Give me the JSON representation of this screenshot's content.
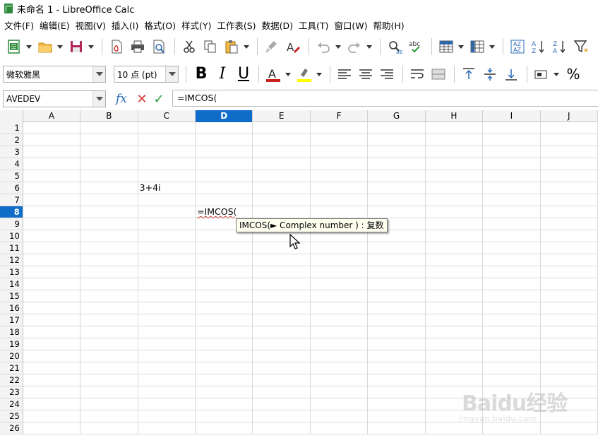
{
  "window": {
    "title": "未命名 1 - LibreOffice Calc"
  },
  "menu": [
    "文件(F)",
    "编辑(E)",
    "视图(V)",
    "插入(I)",
    "格式(O)",
    "样式(Y)",
    "工作表(S)",
    "数据(D)",
    "工具(T)",
    "窗口(W)",
    "帮助(H)"
  ],
  "format": {
    "font_name": "微软雅黑",
    "font_size": "10 点 (pt)",
    "bold": "B",
    "italic": "I",
    "underline": "U",
    "percent": "%"
  },
  "formula_bar": {
    "name_box": "AVEDEV",
    "fx": "fx",
    "cancel": "✕",
    "accept": "✓",
    "content": "=IMCOS("
  },
  "columns": [
    "A",
    "B",
    "C",
    "D",
    "E",
    "F",
    "G",
    "H",
    "I",
    "J"
  ],
  "selected_column": "D",
  "rows": [
    "1",
    "2",
    "3",
    "4",
    "5",
    "6",
    "7",
    "8",
    "9",
    "10",
    "11",
    "12",
    "13",
    "14",
    "15",
    "16",
    "17",
    "18",
    "19",
    "20",
    "21",
    "22",
    "23",
    "24",
    "25",
    "26"
  ],
  "selected_row": "8",
  "cells": {
    "C6": "3+4i",
    "D8": "=IMCOS("
  },
  "tooltip": "IMCOS(► Complex number ) : 复数",
  "watermark": {
    "brand": "Baidu经验",
    "url": "jingyan.baidu.com"
  },
  "colors": {
    "selection": "#0f6dc9",
    "font_color": "#c9211e",
    "highlight": "#ffff00"
  }
}
